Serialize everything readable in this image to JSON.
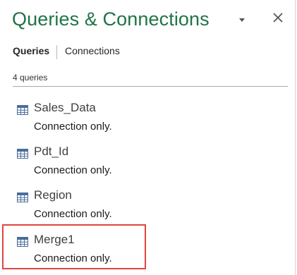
{
  "pane": {
    "title": "Queries & Connections",
    "dropdown_icon": "caret-down-icon",
    "close_icon": "close-icon"
  },
  "tabs": [
    {
      "label": "Queries",
      "active": true
    },
    {
      "label": "Connections",
      "active": false
    }
  ],
  "query_count": "4 queries",
  "queries": [
    {
      "name": "Sales_Data",
      "status": "Connection only.",
      "icon": "table-icon"
    },
    {
      "name": "Pdt_Id",
      "status": "Connection only.",
      "icon": "table-icon"
    },
    {
      "name": "Region",
      "status": "Connection only.",
      "icon": "table-icon"
    },
    {
      "name": "Merge1",
      "status": "Connection only.",
      "icon": "table-icon",
      "highlighted": true
    }
  ],
  "colors": {
    "title": "#217346",
    "highlight_border": "#e0463f",
    "table_icon": "#4a6c9b"
  }
}
